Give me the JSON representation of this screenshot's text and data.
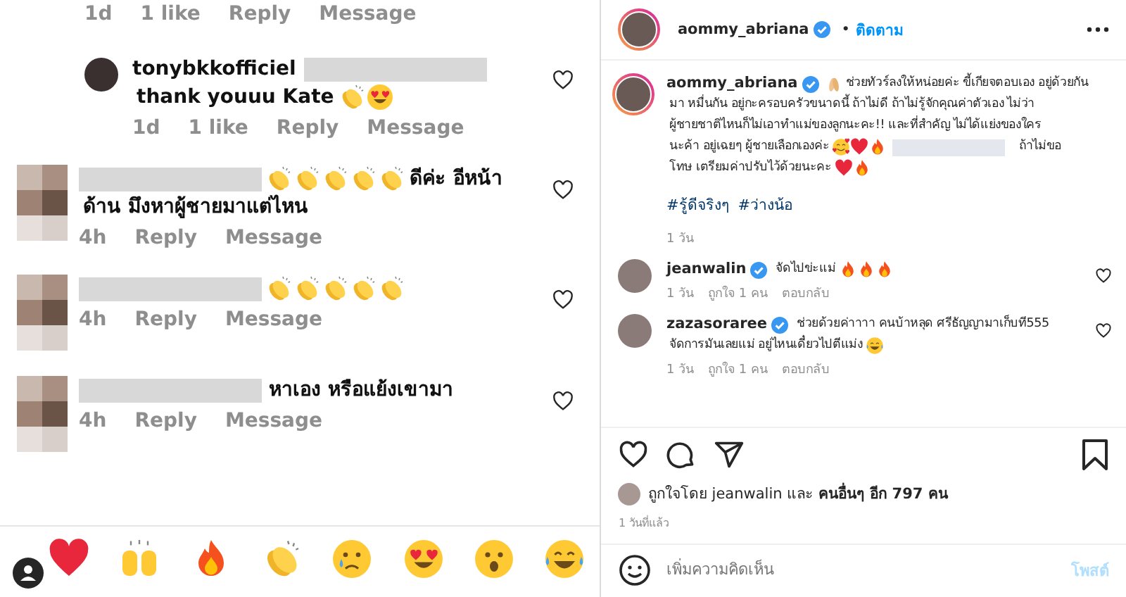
{
  "left": {
    "top_meta": {
      "time": "1d",
      "likes": "1 like",
      "reply": "Reply",
      "message": "Message"
    },
    "comments": [
      {
        "nested": true,
        "avatar": {
          "kind": "photo"
        },
        "username": "tonybkkofficiel",
        "lines": [
          [
            {
              "kind": "blur"
            }
          ],
          [
            {
              "kind": "text",
              "text": "thank youuu Kate"
            },
            {
              "kind": "clap"
            },
            {
              "kind": "heart-eyes"
            }
          ]
        ],
        "meta": {
          "time": "1d",
          "likes": "1 like",
          "reply": "Reply",
          "message": "Message"
        }
      },
      {
        "nested": false,
        "avatar": {
          "kind": "mosaic"
        },
        "lines": [
          [
            {
              "kind": "blur"
            },
            {
              "kind": "clap"
            },
            {
              "kind": "clap"
            },
            {
              "kind": "clap"
            },
            {
              "kind": "clap"
            },
            {
              "kind": "clap"
            },
            {
              "kind": "text",
              "text": "ดีค่ะ อีหน้า"
            }
          ],
          [
            {
              "kind": "text",
              "text": "ด้าน มึงหาผู้ชายมาแต่ไหน"
            }
          ]
        ],
        "meta": {
          "time": "4h",
          "reply": "Reply",
          "message": "Message"
        }
      },
      {
        "nested": false,
        "avatar": {
          "kind": "mosaic"
        },
        "lines": [
          [
            {
              "kind": "blur"
            },
            {
              "kind": "clap"
            },
            {
              "kind": "clap"
            },
            {
              "kind": "clap"
            },
            {
              "kind": "clap"
            },
            {
              "kind": "clap"
            }
          ]
        ],
        "meta": {
          "time": "4h",
          "reply": "Reply",
          "message": "Message"
        }
      },
      {
        "nested": false,
        "avatar": {
          "kind": "mosaic"
        },
        "lines": [
          [
            {
              "kind": "blur"
            },
            {
              "kind": "text",
              "text": "หาเอง หรือแย้งเขามา"
            }
          ]
        ],
        "meta": {
          "time": "4h",
          "reply": "Reply",
          "message": "Message"
        }
      }
    ],
    "quick_reactions": [
      {
        "kind": "heart"
      },
      {
        "kind": "raised-hands"
      },
      {
        "kind": "fire"
      },
      {
        "kind": "clap"
      },
      {
        "kind": "crying"
      },
      {
        "kind": "heart-eyes"
      },
      {
        "kind": "surprised"
      },
      {
        "kind": "laugh-tears"
      }
    ]
  },
  "post": {
    "header": {
      "username": "aommy_abriana",
      "verified": true,
      "separator": "•",
      "follow": "ติดตาม"
    },
    "caption": {
      "username": "aommy_abriana",
      "verified": true,
      "lines": [
        [
          {
            "kind": "pray"
          },
          {
            "kind": "text",
            "text": "ช่วยทัวร์ลงให้หน่อยค่ะ ขี้เกียจตอบเอง อยู่ด้วยกัน"
          }
        ],
        [
          {
            "kind": "text",
            "text": "มา หมื่นกัน อยู่กะครอบครัวขนาดนี้ ถ้าไม่ดี ถ้าไม่รู้จักคุณค่าตัวเอง ไม่ว่า"
          }
        ],
        [
          {
            "kind": "text",
            "text": "ผู้ชายชาติไหนก็ไม่เอาทำแม่ของลูกนะคะ!! และที่สำคัญ ไม่ได้แย่งของใคร"
          }
        ],
        [
          {
            "kind": "text",
            "text": "นะค้า อยู่เฉยๆ ผู้ชายเลือกเองค่ะ"
          },
          {
            "kind": "smile-hearts"
          },
          {
            "kind": "heart"
          },
          {
            "kind": "fire"
          },
          {
            "kind": "blur"
          },
          {
            "kind": "text",
            "text": "ถ้าไม่ขอ"
          }
        ],
        [
          {
            "kind": "text",
            "text": "โทษ เตรียมค่าปรับไว้ด้วยนะคะ"
          },
          {
            "kind": "heart"
          },
          {
            "kind": "fire"
          }
        ]
      ],
      "hashtags": [
        "#รู้ดีจริงๆ",
        "#ว่างน้อ"
      ],
      "time": "1 วัน"
    },
    "comments": [
      {
        "username": "jeanwalin",
        "verified": true,
        "lines": [
          [
            {
              "kind": "text",
              "text": "จัดไปข่ะแม่"
            },
            {
              "kind": "fire"
            },
            {
              "kind": "fire"
            },
            {
              "kind": "fire"
            }
          ]
        ],
        "meta": {
          "time": "1 วัน",
          "likes": "ถูกใจ 1 คน",
          "reply": "ตอบกลับ"
        }
      },
      {
        "username": "zazasoraree",
        "verified": true,
        "lines": [
          [
            {
              "kind": "text",
              "text": "ช่วยด้วยค่าาาา คนบ้าหลุด ศรีธัญญามาเก็บที555"
            }
          ],
          [
            {
              "kind": "text",
              "text": "จัดการมันเลยแม่ อยู่ไหนเดี๋ยวไปตีแม่ง"
            },
            {
              "kind": "laugh-tears"
            }
          ]
        ],
        "meta": {
          "time": "1 วัน",
          "likes": "ถูกใจ 1 คน",
          "reply": "ตอบกลับ"
        }
      }
    ],
    "likes": "ถูกใจโดย jeanwalin และ **คนอื่นๆ อีก 797 คน**",
    "time": "1 วันที่แล้ว",
    "add_comment": {
      "placeholder": "เพิ่มความคิดเห็น",
      "post": "โพสต์",
      "disabled": true
    }
  }
}
